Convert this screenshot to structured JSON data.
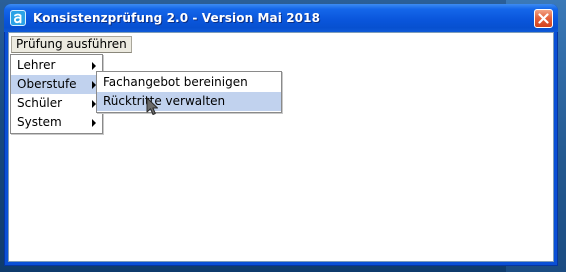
{
  "window": {
    "title": "Konsistenzprüfung 2.0 - Version Mai 2018"
  },
  "menubar": {
    "items": [
      {
        "label": "Prüfung ausführen"
      }
    ]
  },
  "main_menu": {
    "items": [
      {
        "label": "Lehrer",
        "has_submenu": true
      },
      {
        "label": "Oberstufe",
        "has_submenu": true,
        "highlighted": true
      },
      {
        "label": "Schüler",
        "has_submenu": true
      },
      {
        "label": "System",
        "has_submenu": true
      }
    ]
  },
  "submenu": {
    "items": [
      {
        "label": "Fachangebot bereinigen"
      },
      {
        "label": "Rücktritte verwalten",
        "highlighted": true
      }
    ]
  },
  "colors": {
    "titlebar": "#0a56dc",
    "menu_highlight": "#c1d2ee",
    "close_button": "#d2421c"
  },
  "icons": [
    "app-icon",
    "close-icon",
    "submenu-arrow-icon",
    "mouse-pointer-icon"
  ]
}
